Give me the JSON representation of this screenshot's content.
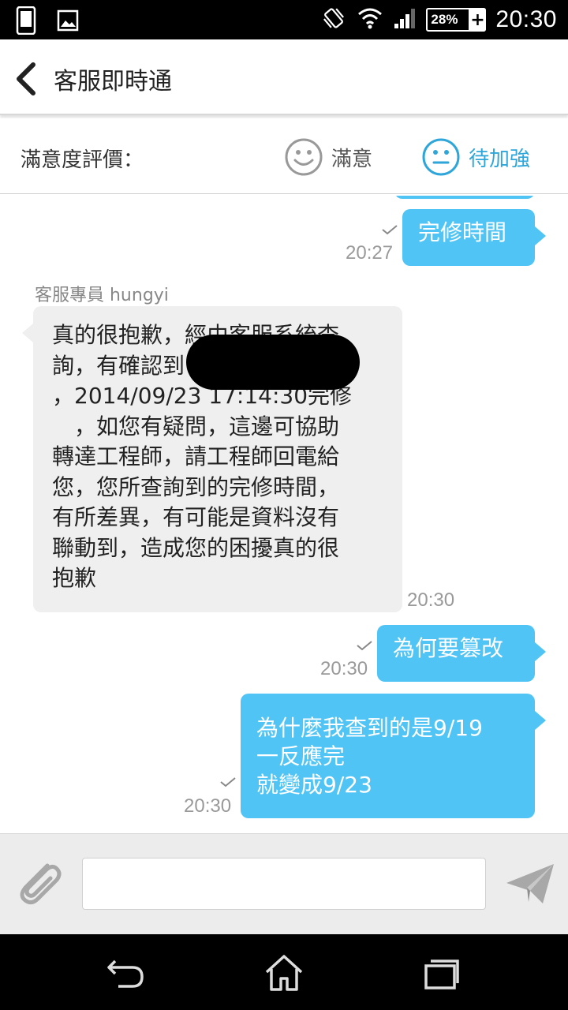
{
  "status_bar": {
    "time": "20:30",
    "battery_percent": "28%",
    "icons": [
      "phone-icon",
      "image-icon",
      "vibrate-icon",
      "wifi-icon",
      "signal-icon",
      "battery-icon"
    ]
  },
  "header": {
    "title": "客服即時通",
    "back_icon": "chevron-left-icon"
  },
  "rating": {
    "label": "滿意度評價：",
    "options": [
      {
        "label": "滿意",
        "icon": "smiley-happy-icon",
        "color": "#555555"
      },
      {
        "label": "待加強",
        "icon": "smiley-neutral-icon",
        "color": "#2ea6d9",
        "selected": true
      }
    ]
  },
  "chat": {
    "messages": [
      {
        "direction": "out",
        "text": "完修時間",
        "time": "20:27",
        "read": true
      },
      {
        "direction": "in",
        "sender": "客服專員 hungyi",
        "text": "真的很抱歉，經由客服系統查\n詢，有確認到\n，2014/09/23 17:14:30完修\n　，如您有疑問，這邊可協助\n轉達工程師，請工程師回電給\n您，您所查詢到的完修時間，\n有所差異，有可能是資料沒有\n聯動到，造成您的困擾真的很\n抱歉",
        "time": "20:30"
      },
      {
        "direction": "out",
        "text": "為何要篡改",
        "time": "20:30",
        "read": true
      },
      {
        "direction": "out",
        "text_lines": [
          "為什麼我查到的是9/19",
          "一反應完",
          "就變成9/23"
        ],
        "time": "20:30",
        "read": true
      }
    ]
  },
  "input": {
    "placeholder": "",
    "value": "",
    "attach_icon": "paperclip-icon",
    "send_icon": "send-icon"
  },
  "colors": {
    "accent": "#2ea6d9",
    "outgoing_bubble": "#50c4f5",
    "incoming_bubble": "#efefef"
  },
  "nav": {
    "icons": [
      "back-nav-icon",
      "home-icon",
      "recents-icon"
    ]
  }
}
